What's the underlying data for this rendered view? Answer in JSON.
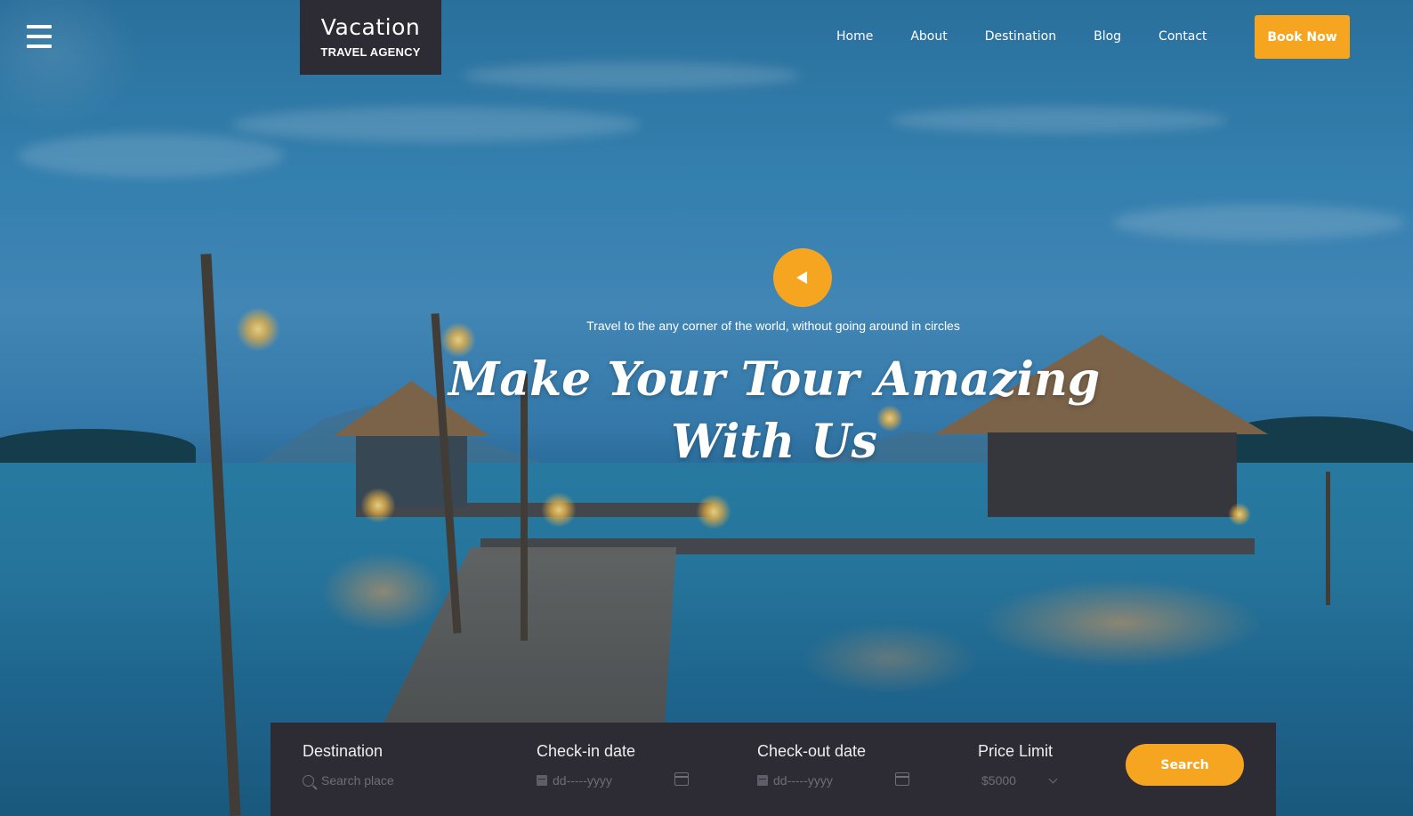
{
  "header": {
    "logo": {
      "title": "Vacation",
      "subtitle": "TRAVEL AGENCY"
    },
    "nav": [
      "Home",
      "About",
      "Destination",
      "Blog",
      "Contact"
    ],
    "cta_label": "Book Now"
  },
  "hero": {
    "tagline": "Travel to the any corner of the world, without going around in circles",
    "headline_line1": "Make Your Tour Amazing",
    "headline_line2": "With Us"
  },
  "search": {
    "destination": {
      "label": "Destination",
      "placeholder": "Search place"
    },
    "checkin": {
      "label": "Check-in date",
      "placeholder": "dd-----yyyy"
    },
    "checkout": {
      "label": "Check-out date",
      "placeholder": "dd-----yyyy"
    },
    "price": {
      "label": "Price Limit",
      "value": "$5000"
    },
    "button_label": "Search"
  },
  "colors": {
    "accent": "#f6a521",
    "panel": "#2d2b34"
  },
  "icons": [
    "menu-icon",
    "play-icon",
    "search-icon",
    "calendar-icon",
    "chevron-down-icon"
  ]
}
